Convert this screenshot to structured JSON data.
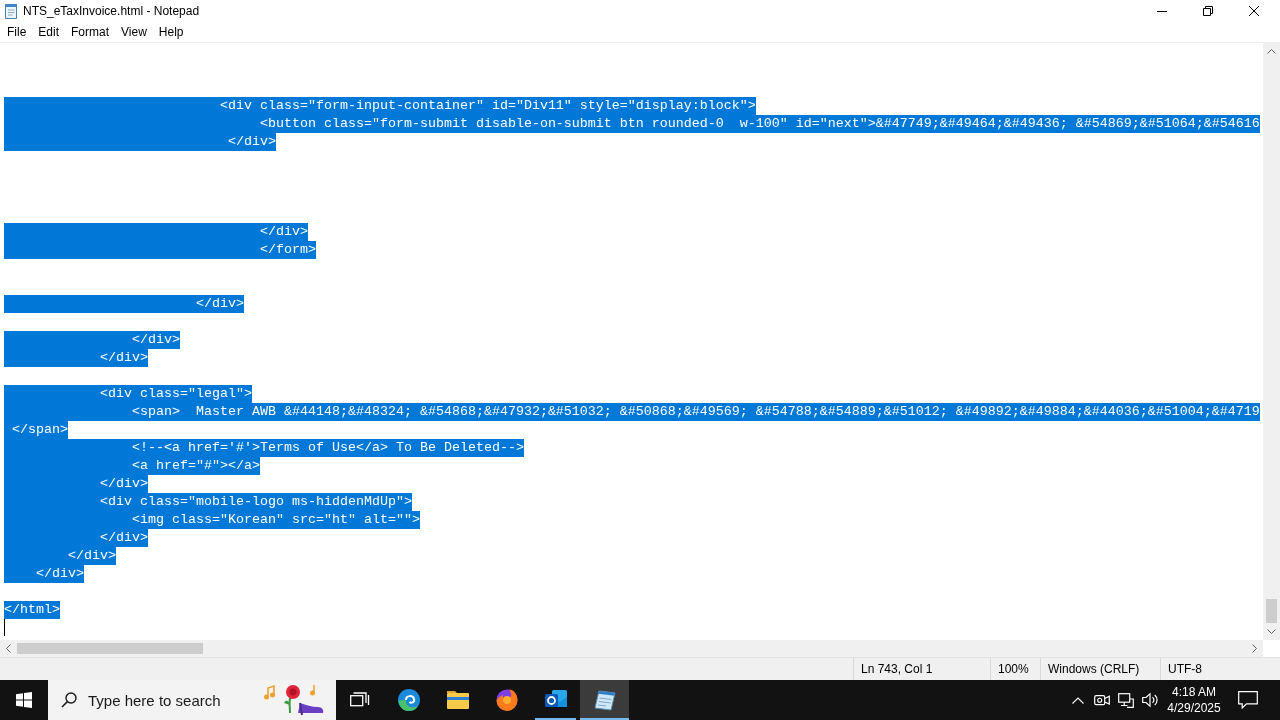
{
  "window": {
    "title": "NTS_eTaxInvoice.html - Notepad"
  },
  "menu": [
    "File",
    "Edit",
    "Format",
    "View",
    "Help"
  ],
  "editor": {
    "lines": [
      {
        "kind": "blank"
      },
      {
        "kind": "blank"
      },
      {
        "kind": "blank"
      },
      {
        "kind": "code",
        "selected": true,
        "text": "                           <div class=\"form-input-container\" id=\"Div11\" style=\"display:block\">"
      },
      {
        "kind": "code",
        "selected": true,
        "text": "                                <button class=\"form-submit disable-on-submit btn rounded-0  w-100\" id=\"next\">&#47749;&#49464;&#49436; &#54869;&#51064;&#54616"
      },
      {
        "kind": "code",
        "selected": true,
        "text": "                            </div>"
      },
      {
        "kind": "blank"
      },
      {
        "kind": "blank"
      },
      {
        "kind": "blank"
      },
      {
        "kind": "blank"
      },
      {
        "kind": "code",
        "selected": true,
        "text": "                                </div>"
      },
      {
        "kind": "code",
        "selected": true,
        "text": "                                </form>"
      },
      {
        "kind": "blank"
      },
      {
        "kind": "blank"
      },
      {
        "kind": "code",
        "selected": true,
        "text": "                        </div>"
      },
      {
        "kind": "blank"
      },
      {
        "kind": "code",
        "selected": true,
        "text": "                </div>"
      },
      {
        "kind": "code",
        "selected": true,
        "text": "            </div>"
      },
      {
        "kind": "blank"
      },
      {
        "kind": "code",
        "selected": true,
        "text": "            <div class=\"legal\">"
      },
      {
        "kind": "code",
        "selected": true,
        "text": "                <span>  Master AWB &#44148;&#48324; &#54868;&#47932;&#51032; &#50868;&#49569; &#54788;&#54889;&#51012; &#49892;&#49884;&#44036;&#51004;&#4719"
      },
      {
        "kind": "code",
        "selected": true,
        "text": " </span>"
      },
      {
        "kind": "code",
        "selected": true,
        "text": "                <!--<a href='#'>Terms of Use</a> To Be Deleted-->"
      },
      {
        "kind": "code",
        "selected": true,
        "text": "                <a href=\"#\"></a>"
      },
      {
        "kind": "code",
        "selected": true,
        "text": "            </div>"
      },
      {
        "kind": "code",
        "selected": true,
        "text": "            <div class=\"mobile-logo ms-hiddenMdUp\">"
      },
      {
        "kind": "code",
        "selected": true,
        "text": "                <img class=\"Korean\" src=\"ht\" alt=\"\">"
      },
      {
        "kind": "code",
        "selected": true,
        "text": "            </div>"
      },
      {
        "kind": "code",
        "selected": true,
        "text": "        </div>"
      },
      {
        "kind": "code",
        "selected": true,
        "text": "    </div>"
      },
      {
        "kind": "blank"
      },
      {
        "kind": "code",
        "selected": true,
        "text": "</html>"
      },
      {
        "kind": "caret"
      }
    ]
  },
  "status_bar": [
    "Ln 743, Col 1",
    "100%",
    "Windows (CRLF)",
    "UTF-8"
  ],
  "taskbar": {
    "search": {
      "placeholder": "Type here to search"
    },
    "apps": [
      {
        "kind": "swirl",
        "running": false,
        "selected": false
      },
      {
        "kind": "folder",
        "running": false,
        "selected": false
      },
      {
        "kind": "flame-globe",
        "running": false,
        "selected": false
      },
      {
        "kind": "mail",
        "running": true,
        "selected": false
      },
      {
        "kind": "notepad",
        "running": true,
        "selected": true
      }
    ],
    "clock": {
      "time": "4:18 AM",
      "date": "4/29/2025"
    }
  }
}
